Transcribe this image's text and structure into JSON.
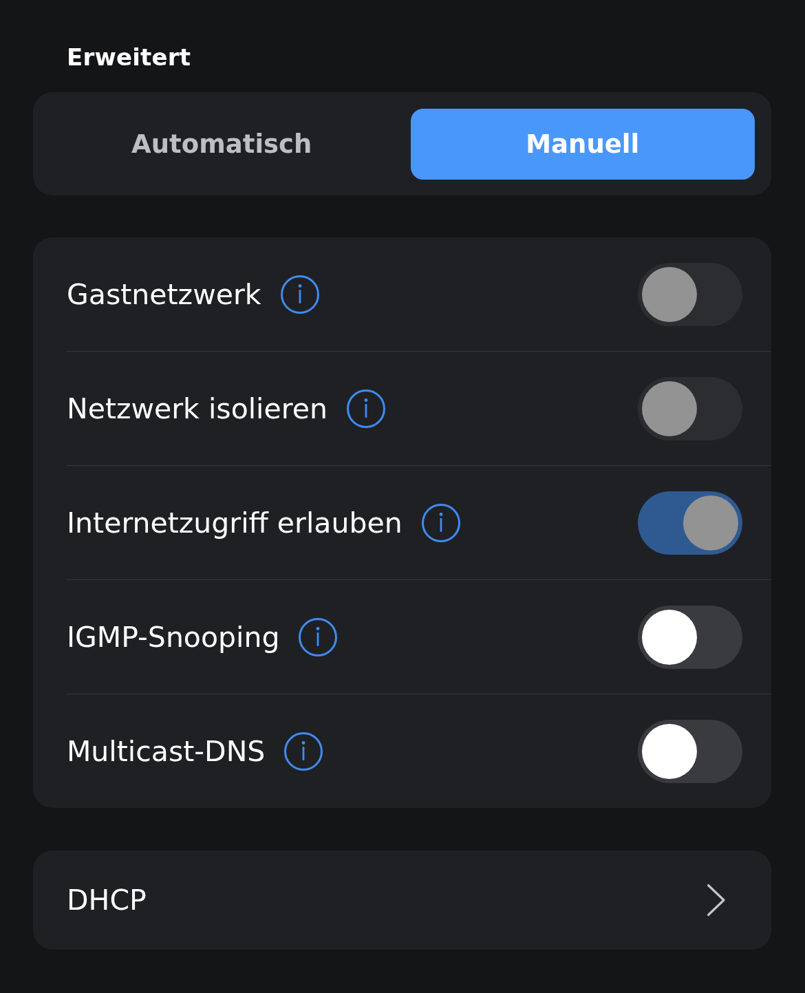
{
  "section_title": "Erweitert",
  "mode_switch": [
    {
      "label": "Automatisch",
      "selected": false
    },
    {
      "label": "Manuell",
      "selected": true
    }
  ],
  "settings": [
    {
      "label": "Gastnetzwerk",
      "on": false,
      "disabled": true
    },
    {
      "label": "Netzwerk isolieren",
      "on": false,
      "disabled": true
    },
    {
      "label": "Internetzugriff erlauben",
      "on": true,
      "disabled": true
    },
    {
      "label": "IGMP-Snooping",
      "on": false,
      "disabled": false
    },
    {
      "label": "Multicast-DNS",
      "on": false,
      "disabled": false
    }
  ],
  "links": [
    {
      "label": "DHCP"
    }
  ]
}
